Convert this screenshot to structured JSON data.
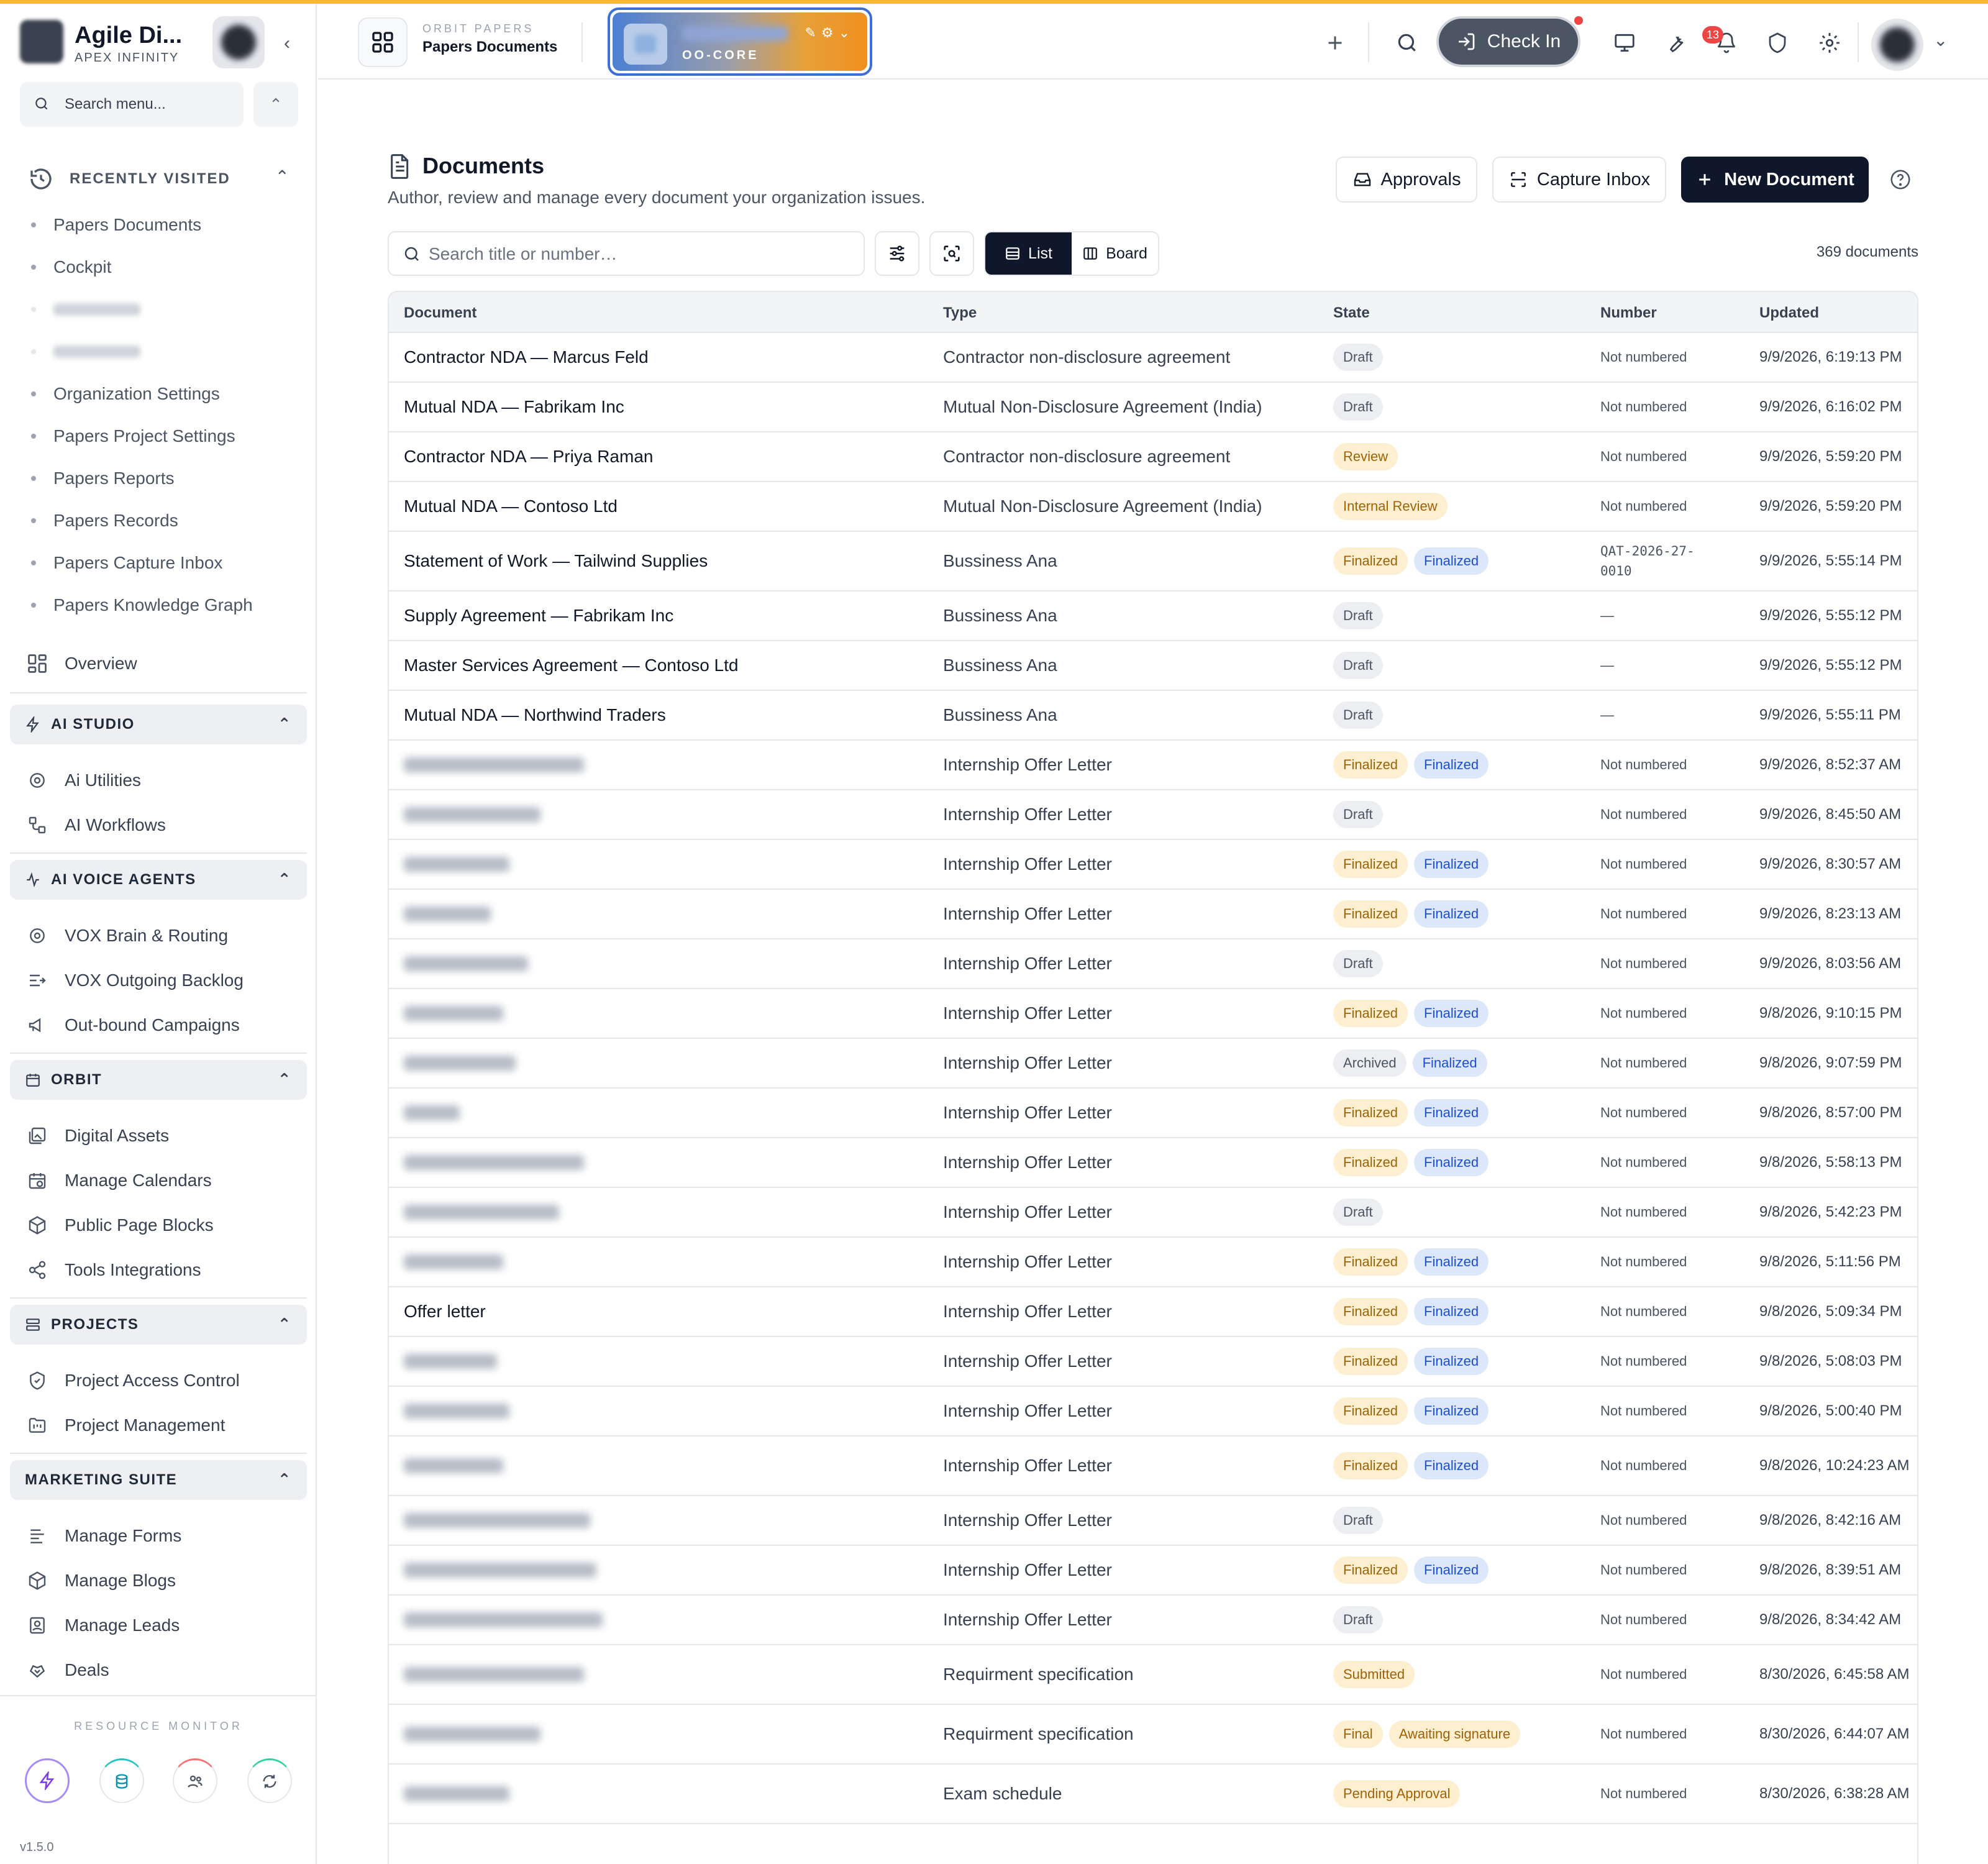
{
  "sidebar": {
    "brand_name": "Agile Di...",
    "brand_sub": "APEX INFINITY",
    "search_placeholder": "Search menu...",
    "recently_visited_label": "RECENTLY VISITED",
    "recent_items": [
      "Papers Documents",
      "Cockpit",
      "",
      "",
      "Organization Settings",
      "Papers Project Settings",
      "Papers Reports",
      "Papers Records",
      "Papers Capture Inbox",
      "Papers Knowledge Graph"
    ],
    "overview_label": "Overview",
    "ai_studio": {
      "label": "AI STUDIO",
      "items": [
        "Ai Utilities",
        "AI Workflows"
      ]
    },
    "ai_voice_agents": {
      "label": "AI VOICE AGENTS",
      "items": [
        "VOX Brain & Routing",
        "VOX Outgoing Backlog",
        "Out-bound Campaigns"
      ]
    },
    "orbit": {
      "label": "ORBIT",
      "items": [
        "Digital Assets",
        "Manage Calendars",
        "Public Page Blocks",
        "Tools Integrations"
      ]
    },
    "projects": {
      "label": "PROJECTS",
      "items": [
        "Project Access Control",
        "Project Management"
      ]
    },
    "marketing_suite": {
      "label": "MARKETING SUITE",
      "items": [
        "Manage Forms",
        "Manage Blogs",
        "Manage Leads",
        "Deals"
      ]
    },
    "resource_monitor_label": "RESOURCE MONITOR",
    "version": "v1.5.0"
  },
  "topbar": {
    "app_sub": "ORBIT PAPERS",
    "app_title": "Papers Documents",
    "workspace_code": "OO-CORE",
    "checkin_label": "Check In",
    "notification_count": "13"
  },
  "page": {
    "title": "Documents",
    "subtitle": "Author, review and manage every document your organization issues.",
    "approvals_label": "Approvals",
    "capture_inbox_label": "Capture Inbox",
    "new_document_label": "New Document",
    "search_placeholder": "Search title or number…",
    "view_list_label": "List",
    "view_board_label": "Board",
    "doc_count": "369 documents"
  },
  "table": {
    "columns": [
      "Document",
      "Type",
      "State",
      "Number",
      "Updated"
    ],
    "rows": [
      {
        "document": "Contractor NDA — Marcus Feld",
        "type": "Contractor non-disclosure agreement",
        "states": [
          "Draft"
        ],
        "number": "Not numbered",
        "updated": "9/9/2026, 6:19:13 PM"
      },
      {
        "document": "Mutual NDA — Fabrikam Inc",
        "type": "Mutual Non-Disclosure Agreement (India)",
        "states": [
          "Draft"
        ],
        "number": "Not numbered",
        "updated": "9/9/2026, 6:16:02 PM"
      },
      {
        "document": "Contractor NDA — Priya Raman",
        "type": "Contractor non-disclosure agreement",
        "states": [
          "Review"
        ],
        "number": "Not numbered",
        "updated": "9/9/2026, 5:59:20 PM"
      },
      {
        "document": "Mutual NDA — Contoso Ltd",
        "type": "Mutual Non-Disclosure Agreement (India)",
        "states": [
          "Internal Review"
        ],
        "number": "Not numbered",
        "updated": "9/9/2026, 5:59:20 PM"
      },
      {
        "document": "Statement of Work — Tailwind Supplies",
        "type": "Bussiness Ana",
        "states": [
          "Finalized",
          "Finalized"
        ],
        "number": "QAT-2026-27-\n0010",
        "updated": "9/9/2026, 5:55:14 PM"
      },
      {
        "document": "Supply Agreement — Fabrikam Inc",
        "type": "Bussiness Ana",
        "states": [
          "Draft"
        ],
        "number": "—",
        "updated": "9/9/2026, 5:55:12 PM"
      },
      {
        "document": "Master Services Agreement — Contoso Ltd",
        "type": "Bussiness Ana",
        "states": [
          "Draft"
        ],
        "number": "—",
        "updated": "9/9/2026, 5:55:12 PM"
      },
      {
        "document": "Mutual NDA — Northwind Traders",
        "type": "Bussiness Ana",
        "states": [
          "Draft"
        ],
        "number": "—",
        "updated": "9/9/2026, 5:55:11 PM"
      },
      {
        "document": "",
        "type": "Internship Offer Letter",
        "states": [
          "Finalized",
          "Finalized"
        ],
        "number": "Not numbered",
        "updated": "9/9/2026, 8:52:37 AM"
      },
      {
        "document": "",
        "type": "Internship Offer Letter",
        "states": [
          "Draft"
        ],
        "number": "Not numbered",
        "updated": "9/9/2026, 8:45:50 AM"
      },
      {
        "document": "",
        "type": "Internship Offer Letter",
        "states": [
          "Finalized",
          "Finalized"
        ],
        "number": "Not numbered",
        "updated": "9/9/2026, 8:30:57 AM"
      },
      {
        "document": "",
        "type": "Internship Offer Letter",
        "states": [
          "Finalized",
          "Finalized"
        ],
        "number": "Not numbered",
        "updated": "9/9/2026, 8:23:13 AM"
      },
      {
        "document": "",
        "type": "Internship Offer Letter",
        "states": [
          "Draft"
        ],
        "number": "Not numbered",
        "updated": "9/9/2026, 8:03:56 AM"
      },
      {
        "document": "",
        "type": "Internship Offer Letter",
        "states": [
          "Finalized",
          "Finalized"
        ],
        "number": "Not numbered",
        "updated": "9/8/2026, 9:10:15 PM"
      },
      {
        "document": "",
        "type": "Internship Offer Letter",
        "states": [
          "Archived",
          "Finalized"
        ],
        "number": "Not numbered",
        "updated": "9/8/2026, 9:07:59 PM"
      },
      {
        "document": "",
        "type": "Internship Offer Letter",
        "states": [
          "Finalized",
          "Finalized"
        ],
        "number": "Not numbered",
        "updated": "9/8/2026, 8:57:00 PM"
      },
      {
        "document": "",
        "type": "Internship Offer Letter",
        "states": [
          "Finalized",
          "Finalized"
        ],
        "number": "Not numbered",
        "updated": "9/8/2026, 5:58:13 PM"
      },
      {
        "document": "",
        "type": "Internship Offer Letter",
        "states": [
          "Draft"
        ],
        "number": "Not numbered",
        "updated": "9/8/2026, 5:42:23 PM"
      },
      {
        "document": "",
        "type": "Internship Offer Letter",
        "states": [
          "Finalized",
          "Finalized"
        ],
        "number": "Not numbered",
        "updated": "9/8/2026, 5:11:56 PM"
      },
      {
        "document": "Offer letter",
        "type": "Internship Offer Letter",
        "states": [
          "Finalized",
          "Finalized"
        ],
        "number": "Not numbered",
        "updated": "9/8/2026, 5:09:34 PM"
      },
      {
        "document": "",
        "type": "Internship Offer Letter",
        "states": [
          "Finalized",
          "Finalized"
        ],
        "number": "Not numbered",
        "updated": "9/8/2026, 5:08:03 PM"
      },
      {
        "document": "",
        "type": "Internship Offer Letter",
        "states": [
          "Finalized",
          "Finalized"
        ],
        "number": "Not numbered",
        "updated": "9/8/2026, 5:00:40 PM"
      },
      {
        "document": "",
        "type": "Internship Offer Letter",
        "states": [
          "Finalized",
          "Finalized"
        ],
        "number": "Not numbered",
        "updated": "9/8/2026, 10:24:23 AM"
      },
      {
        "document": "",
        "type": "Internship Offer Letter",
        "states": [
          "Draft"
        ],
        "number": "Not numbered",
        "updated": "9/8/2026, 8:42:16 AM"
      },
      {
        "document": "",
        "type": "Internship Offer Letter",
        "states": [
          "Finalized",
          "Finalized"
        ],
        "number": "Not numbered",
        "updated": "9/8/2026, 8:39:51 AM"
      },
      {
        "document": "",
        "type": "Internship Offer Letter",
        "states": [
          "Draft"
        ],
        "number": "Not numbered",
        "updated": "9/8/2026, 8:34:42 AM"
      },
      {
        "document": "",
        "type": "Requirment specification",
        "states": [
          "Submitted"
        ],
        "number": "Not numbered",
        "updated": "8/30/2026, 6:45:58 AM"
      },
      {
        "document": "",
        "type": "Requirment specification",
        "states": [
          "Final",
          "Awaiting signature"
        ],
        "number": "Not numbered",
        "updated": "8/30/2026, 6:44:07 AM"
      },
      {
        "document": "",
        "type": "Exam schedule",
        "states": [
          "Pending Approval"
        ],
        "number": "Not numbered",
        "updated": "8/30/2026, 6:38:28 AM"
      }
    ]
  },
  "colors": {
    "accent_top": "#f5b92e",
    "primary_dark": "#0f172a",
    "badge_gray_bg": "#eceef1",
    "badge_amber_bg": "#fdefcf",
    "badge_blue_bg": "#dce7f9",
    "notification_red": "#ef4444"
  }
}
